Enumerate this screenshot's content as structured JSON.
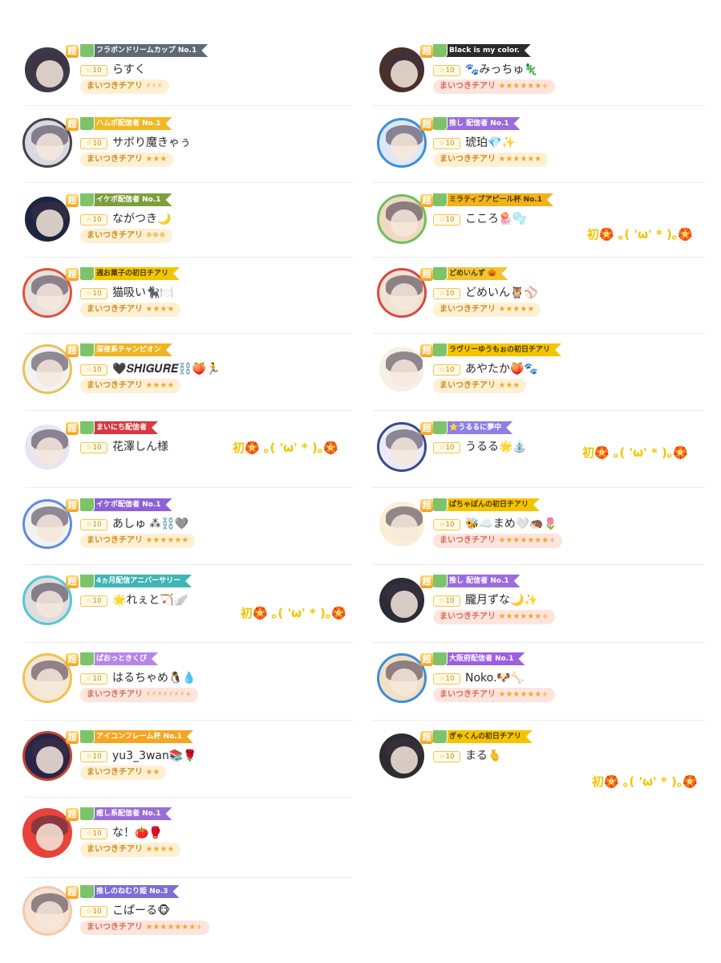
{
  "left": [
    {
      "banner": "フラボンドリームカップ No.1",
      "banner_color": "#5e6a73",
      "name": "らすく",
      "level": "10",
      "cheer": "まいつきチアリ",
      "stars": "⚡⚡⚡",
      "pink": false,
      "avatar_color": "#3b3b48",
      "frame_color": "#ffffff"
    },
    {
      "banner": "ハムポ配信者 No.1",
      "banner_color": "#f2b820",
      "name": "サボり魔きゃぅ",
      "level": "10",
      "cheer": "まいつきチアリ",
      "stars": "★★★",
      "pink": false,
      "avatar_color": "#d9d9e3",
      "frame_color": "#444444"
    },
    {
      "banner": "イケボ配信者 No.1",
      "banner_color": "#7c9f3b",
      "name": "ながつき🌙",
      "level": "10",
      "cheer": "まいつきチアリ",
      "stars": "✵✵✵",
      "pink": false,
      "avatar_color": "#1d2540",
      "frame_color": "#ffffff"
    },
    {
      "banner": "週お菓子の初日チアリ",
      "banner_color": "#f5c400",
      "name": "猫吸い🐈‍⬛🍽️",
      "level": "10",
      "cheer": "まいつきチアリ",
      "stars": "★★★★",
      "pink": false,
      "avatar_color": "#e8e2dc",
      "frame_color": "#e2503c"
    },
    {
      "banner": "深夜系チャンピオン",
      "banner_color": "#f0b323",
      "name": "🖤𝑺𝑯𝑰𝑮𝑼𝑹𝑬⛓️🍑🏃",
      "level": "10",
      "cheer": "まいつきチアリ",
      "stars": "★★★★",
      "pink": false,
      "avatar_color": "#f3f3f3",
      "frame_color": "#e6c25a"
    },
    {
      "banner": "まいにち配信者",
      "banner_color": "#d8373e",
      "name": "花澤しん様",
      "level": "10",
      "cheer": "",
      "stars": "",
      "pink": false,
      "avatar_color": "#e9e4ef",
      "frame_color": "#ffffff",
      "side": "初🏵️ ｡( 'ω' * )｡🏵️"
    },
    {
      "banner": "イケボ配信者 No.1",
      "banner_color": "#8d62d6",
      "name": "あしゅ ⁂⛓️🩶",
      "level": "10",
      "cheer": "まいつきチアリ",
      "stars": "★★★★★★",
      "pink": false,
      "avatar_color": "#f2f2f2",
      "frame_color": "#5f8be0"
    },
    {
      "banner": "4ヵ月配信アニバーサリー",
      "banner_color": "#3fb5b6",
      "name": "🌟れぇと🏹🪽",
      "level": "10",
      "cheer": "",
      "stars": "",
      "pink": false,
      "avatar_color": "#dddddd",
      "frame_color": "#57c4d8",
      "side": "初🏵️ ｡( 'ω' * )｡🏵️"
    },
    {
      "banner": "ぱおっときくび",
      "banner_color": "#b685e8",
      "name": "はるちゃめ🐧💧",
      "level": "10",
      "cheer": "まいつきチアリ",
      "stars": "⚡⚡⚡⚡⚡⚡⚡+",
      "pink": true,
      "avatar_color": "#f5e6d5",
      "frame_color": "#f0c34a"
    },
    {
      "banner": "アイコンフレーム杯 No.1",
      "banner_color": "#f4a621",
      "name": "yu3_3wan📚🌹",
      "level": "10",
      "cheer": "まいつきチアリ",
      "stars": "★★",
      "pink": false,
      "avatar_color": "#2a2448",
      "frame_color": "#c0452f"
    },
    {
      "banner": "癒し系配信者 No.1",
      "banner_color": "#9a6ed6",
      "name": "な！🍅🥊",
      "level": "10",
      "cheer": "まいつきチアリ",
      "stars": "★★★★",
      "pink": false,
      "avatar_color": "#e8433b",
      "frame_color": "#e8433b"
    },
    {
      "banner": "推しのねむり姫 No.3",
      "banner_color": "#7e6cd6",
      "name": "こぱーる🐵",
      "level": "10",
      "cheer": "まいつきチアリ",
      "stars": "★★★★★★★+",
      "pink": true,
      "avatar_color": "#f6e2cf",
      "frame_color": "#f0c9b0"
    }
  ],
  "right": [
    {
      "banner": "Black is my color.",
      "banner_color": "#2b2b2b",
      "name": "🐾みっちゅ🦎",
      "level": "10",
      "cheer": "まいつきチアリ",
      "stars": "★★★★★★+",
      "pink": true,
      "avatar_color": "#4a2f2a",
      "frame_color": "#ffffff"
    },
    {
      "banner": "推し 配信者 No.1",
      "banner_color": "#9b6be0",
      "name": "琥珀💎✨",
      "level": "10",
      "cheer": "まいつきチアリ",
      "stars": "★★★★★★",
      "pink": false,
      "avatar_color": "#dfe7f5",
      "frame_color": "#3b8fd6"
    },
    {
      "banner": "ミラティブアピール杯 No.1",
      "banner_color": "#f1b21b",
      "name": "こころ🪼🫧",
      "level": "10",
      "cheer": "",
      "stars": "",
      "pink": false,
      "avatar_color": "#f0d9c4",
      "frame_color": "#6fbf5a",
      "side": "初🏵️ ｡( 'ω' * )｡🏵️"
    },
    {
      "banner": "どめいんず 🎃",
      "banner_color": "#f3c230",
      "name": "どめいん🦉⚾",
      "level": "10",
      "cheer": "まいつきチアリ",
      "stars": "★★★★★",
      "pink": false,
      "avatar_color": "#f0e3d3",
      "frame_color": "#d94747"
    },
    {
      "banner": "ラヴリーゆうもぉの初日チアリ",
      "banner_color": "#f5c400",
      "name": "あやたか🍑🐾",
      "level": "10",
      "cheer": "まいつきチアリ",
      "stars": "★★★",
      "pink": false,
      "avatar_color": "#f6efe6",
      "frame_color": "#ffffff"
    },
    {
      "banner": "⭐うるるに夢中",
      "banner_color": "#8f7ee6",
      "name": "うるる🌟⛲",
      "level": "10",
      "cheer": "",
      "stars": "",
      "pink": false,
      "avatar_color": "#ecebf5",
      "frame_color": "#3a4a8a",
      "side": "初🏵️ ｡( 'ω' * )｡🏵️"
    },
    {
      "banner": "ぱちゃぽんの初日チアリ",
      "banner_color": "#f5c400",
      "name": "🐝☁️まめ🤍🦔🌷",
      "level": "10",
      "cheer": "まいつきチアリ",
      "stars": "★★★★★★★+",
      "pink": true,
      "avatar_color": "#fbeed7",
      "frame_color": "#ffffff"
    },
    {
      "banner": "推し 配信者 No.1",
      "banner_color": "#9b6be0",
      "name": "朧月ずな🌙✨",
      "level": "10",
      "cheer": "まいつきチアリ",
      "stars": "★★★★★★+",
      "pink": true,
      "avatar_color": "#2c2c36",
      "frame_color": "#ffffff"
    },
    {
      "banner": "大阪府配信者 No.1",
      "banner_color": "#9d5ee0",
      "name": "Noko.🐶🦴",
      "level": "10",
      "cheer": "まいつきチアリ",
      "stars": "★★★★★★+",
      "pink": true,
      "avatar_color": "#f2e0c6",
      "frame_color": "#3b8fd6"
    },
    {
      "banner": "ぎゃくんの初日チアリ",
      "banner_color": "#f5c400",
      "name": "まる🫰",
      "level": "10",
      "cheer": "",
      "stars": "",
      "pink": false,
      "avatar_color": "#2d2d2d",
      "frame_color": "#ffffff",
      "side": "初🏵️ ｡( 'ω' * )｡🏵️"
    }
  ]
}
